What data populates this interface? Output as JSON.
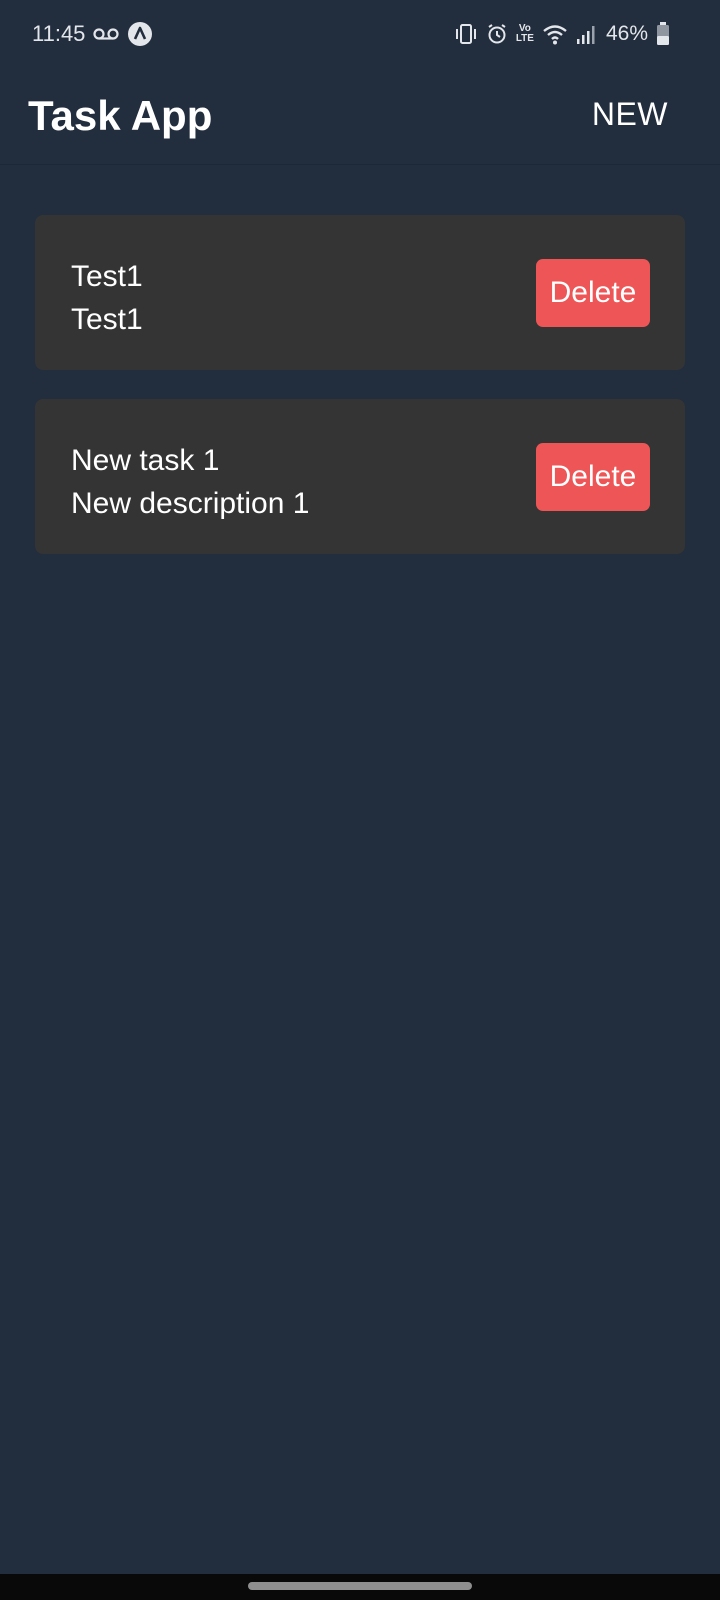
{
  "status_bar": {
    "time": "11:45",
    "battery_percent": "46%",
    "icons": [
      "voicemail-icon",
      "app-notification-icon",
      "vibrate-icon",
      "alarm-icon",
      "volte-icon",
      "wifi-icon",
      "signal-icon",
      "battery-icon"
    ],
    "volte_top": "Vo",
    "volte_bottom": "LTE",
    "battery_level": 0.46
  },
  "app_bar": {
    "title": "Task App",
    "new_label": "NEW"
  },
  "tasks": [
    {
      "title": "Test1",
      "description": "Test1",
      "delete_label": "Delete"
    },
    {
      "title": "New task 1",
      "description": "New description 1",
      "delete_label": "Delete"
    }
  ],
  "colors": {
    "background": "#222d3d",
    "card": "#343434",
    "delete": "#ee5557",
    "text": "#ffffff"
  }
}
